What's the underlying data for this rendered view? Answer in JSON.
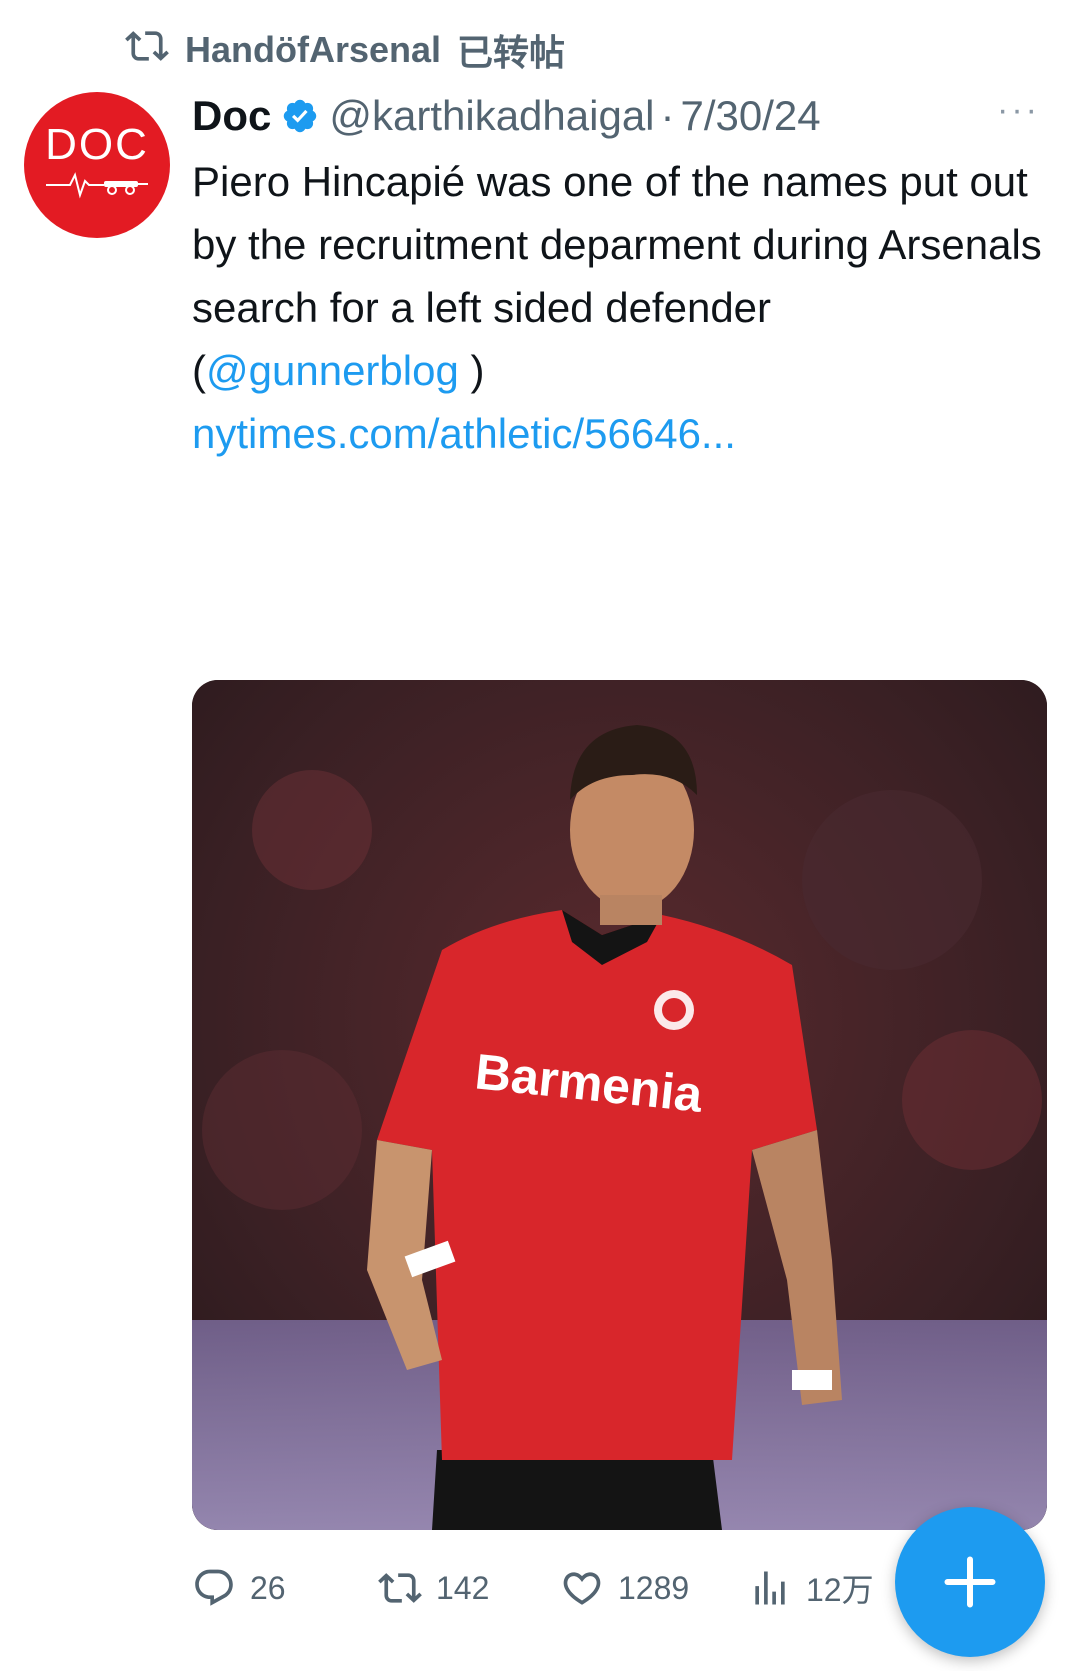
{
  "repost": {
    "user": "HandöfArsenal",
    "suffix": "已转帖"
  },
  "tweet": {
    "avatar_text": "DOC",
    "display_name": "Doc",
    "handle": "@karthikadhaigal",
    "separator": "·",
    "date": "7/30/24",
    "more_label": "···",
    "text": "Piero Hincapié was one of the names put out by the recruitment deparment during Arsenals search for a left sided defender",
    "mention_open": "(",
    "mention": "@gunnerblog",
    "mention_close": " )",
    "link": "nytimes.com/athletic/56646...",
    "media": {
      "sponsor_text": "Barmenia"
    }
  },
  "actions": {
    "replies": "26",
    "reposts": "142",
    "likes": "1289",
    "views": "12万"
  },
  "colors": {
    "accent": "#1d9bf0",
    "muted": "#536471",
    "avatar_bg": "#e31b23"
  },
  "icons": {
    "repost_header": "repost-icon",
    "verified": "verified-badge-icon",
    "reply": "reply-icon",
    "repost": "repost-icon",
    "like": "heart-icon",
    "views": "views-chart-icon",
    "compose": "plus-icon"
  }
}
